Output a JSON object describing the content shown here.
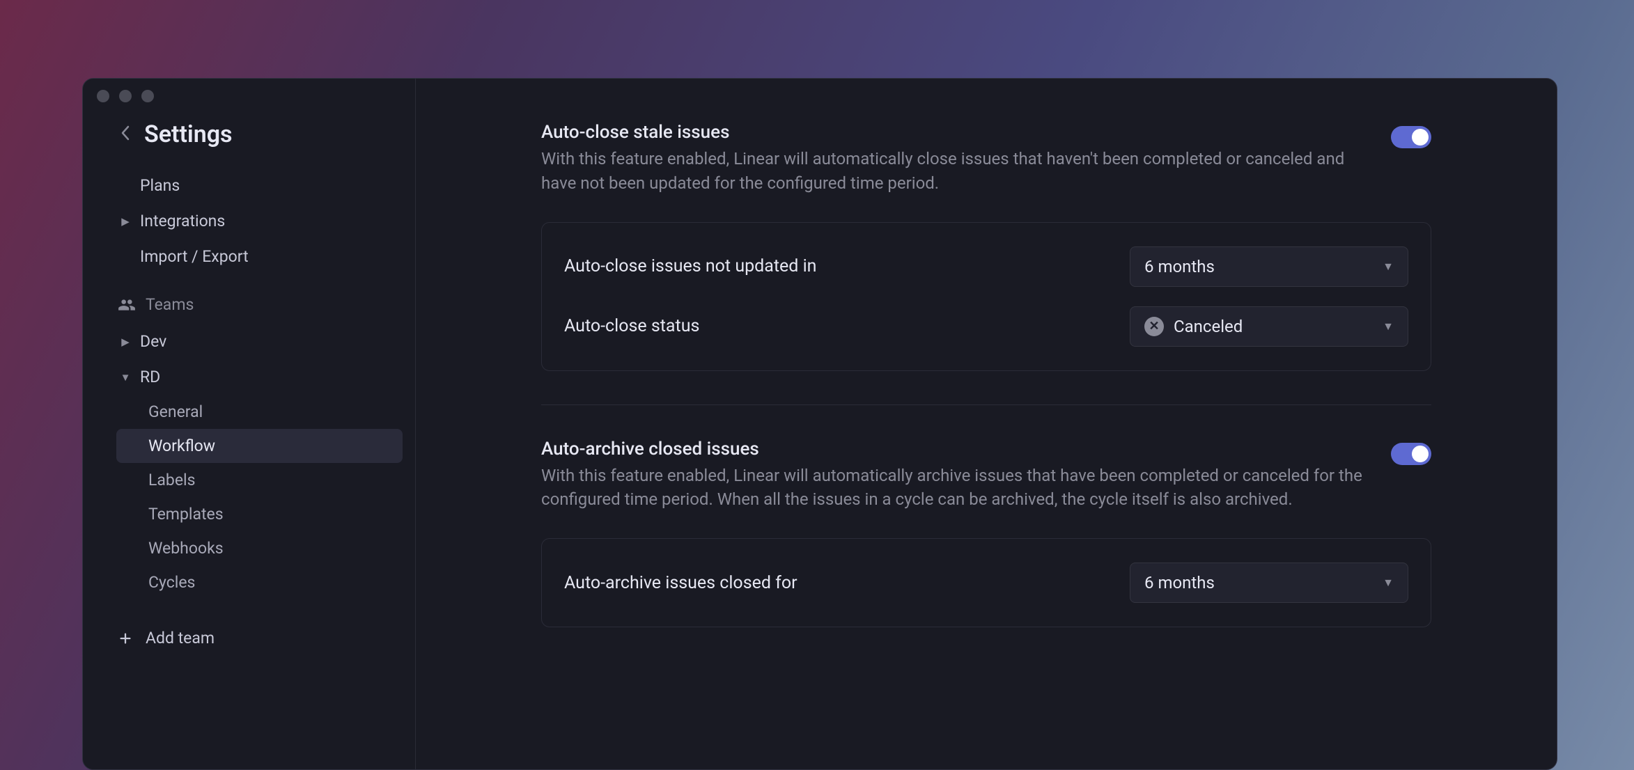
{
  "header": {
    "title": "Settings"
  },
  "sidebar": {
    "items": {
      "plans": "Plans",
      "integrations": "Integrations",
      "import_export": "Import / Export"
    },
    "teams_label": "Teams",
    "teams": {
      "dev": "Dev",
      "rd": "RD"
    },
    "rd_sub": {
      "general": "General",
      "workflow": "Workflow",
      "labels": "Labels",
      "templates": "Templates",
      "webhooks": "Webhooks",
      "cycles": "Cycles"
    },
    "add_team": "Add team"
  },
  "autoclose": {
    "title": "Auto-close stale issues",
    "desc": "With this feature enabled, Linear will automatically close issues that haven't been completed or canceled and have not been updated for the configured time period.",
    "row1_label": "Auto-close issues not updated in",
    "row1_value": "6 months",
    "row2_label": "Auto-close status",
    "row2_value": "Canceled"
  },
  "autoarchive": {
    "title": "Auto-archive closed issues",
    "desc": "With this feature enabled, Linear will automatically archive issues that have been completed or canceled for the configured time period. When all the issues in a cycle can be archived, the cycle itself is also archived.",
    "row1_label": "Auto-archive issues closed for",
    "row1_value": "6 months"
  }
}
